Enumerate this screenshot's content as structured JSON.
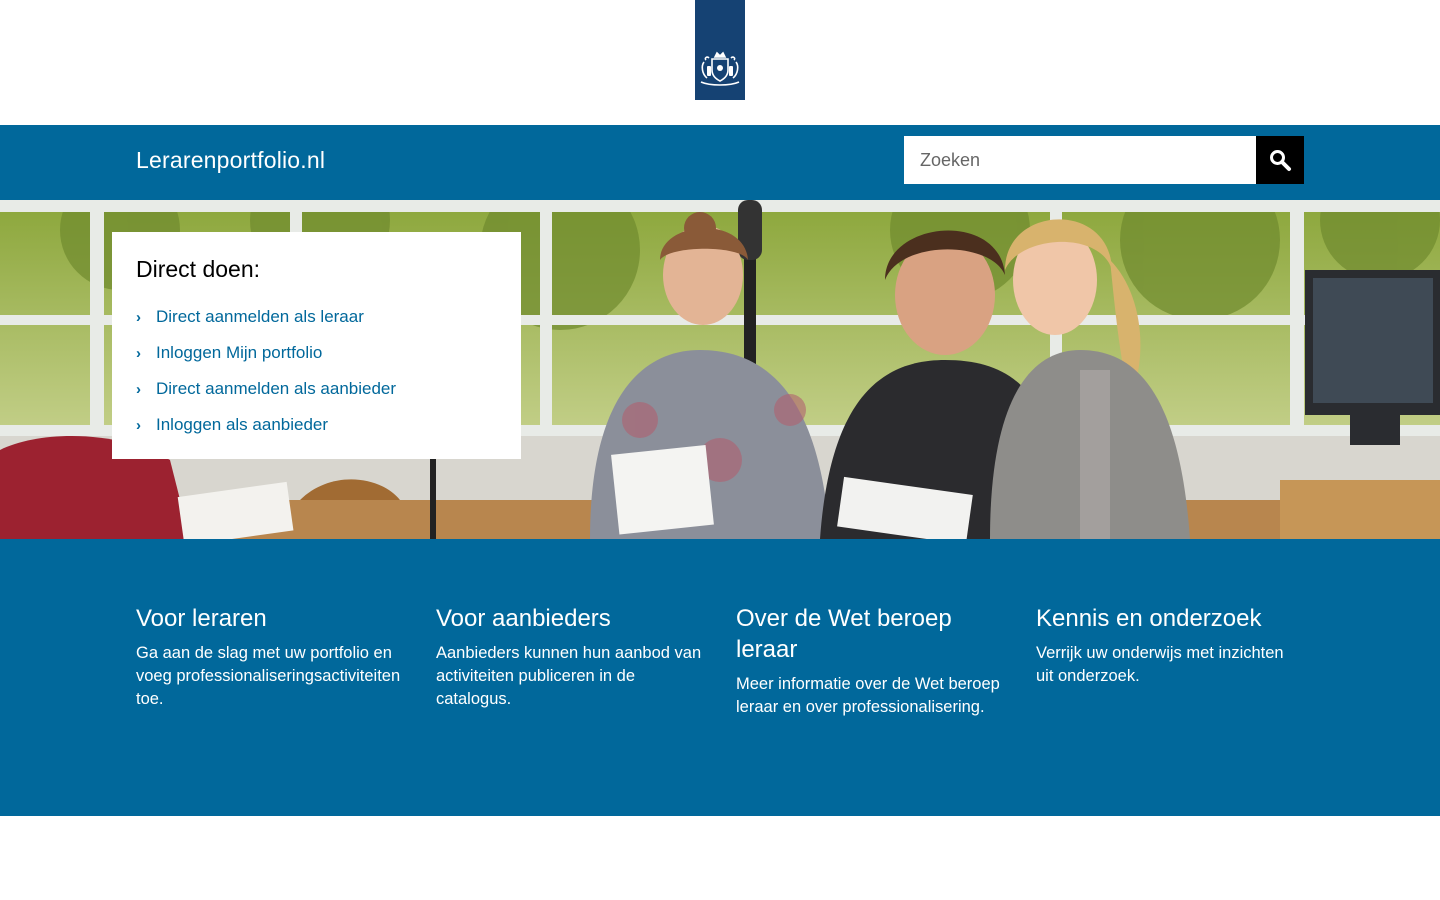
{
  "header": {
    "logo_icon": "coat-of-arms-icon",
    "site_title": "Lerarenportfolio.nl",
    "search": {
      "placeholder": "Zoeken",
      "value": ""
    },
    "search_icon": "search-icon"
  },
  "direct": {
    "title": "Direct doen:",
    "links": [
      {
        "label": "Direct aanmelden als leraar"
      },
      {
        "label": "Inloggen Mijn portfolio"
      },
      {
        "label": "Direct aanmelden als aanbieder"
      },
      {
        "label": "Inloggen als aanbieder"
      }
    ]
  },
  "columns": [
    {
      "title": "Voor leraren",
      "text": "Ga aan de slag met uw portfolio en voeg professionaliseringsactiviteiten toe."
    },
    {
      "title": "Voor aanbieders",
      "text": "Aanbieders kunnen hun aanbod van activiteiten publiceren in de catalogus."
    },
    {
      "title": "Over de Wet beroep leraar",
      "text": "Meer informatie over de Wet beroep leraar en over professionalisering."
    },
    {
      "title": "Kennis en onderzoek",
      "text": "Verrijk uw onderwijs met inzichten uit onderzoek."
    }
  ],
  "colors": {
    "brand_blue": "#01689b",
    "logo_blue": "#154273"
  }
}
